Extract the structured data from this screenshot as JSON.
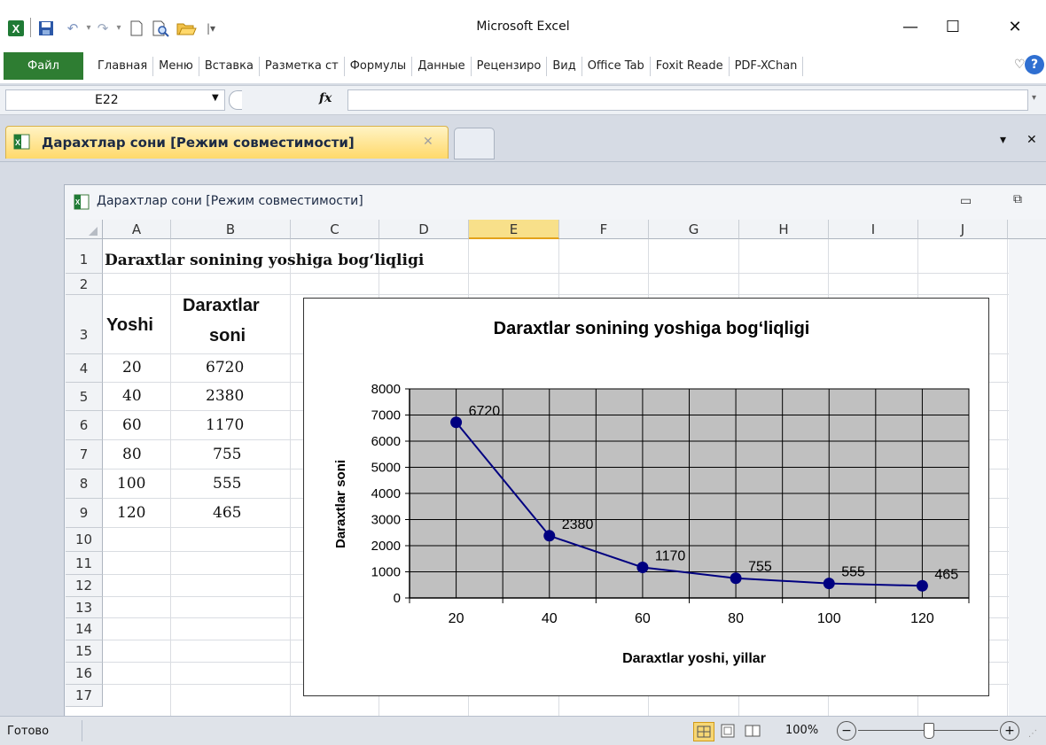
{
  "window": {
    "title": "Microsoft Excel",
    "minimize_glyph": "—",
    "maximize_glyph": "☐",
    "close_glyph": "✕",
    "quick_access": [
      "excel-logo-icon",
      "save-icon",
      "undo-icon",
      "dropdown-icon",
      "redo-icon",
      "dropdown-icon",
      "new-document-icon",
      "print-preview-icon",
      "open-folder-icon",
      "customize-icon"
    ]
  },
  "ribbon": {
    "file_label": "Файл",
    "tabs": [
      "Главная",
      "Меню",
      "Вставка",
      "Разметка ст",
      "Формулы",
      "Данные",
      "Рецензиро",
      "Вид",
      "Office Tab",
      "Foxit Reade",
      "PDF-XChan"
    ],
    "collapse_glyph": "♡",
    "help_glyph": "?"
  },
  "formula_bar": {
    "name_box": "E22",
    "fx_label": "fx",
    "formula": ""
  },
  "doc_tabs": {
    "active_label": "Дарахтлар сони  [Режим совместимости]",
    "close_glyph": "✕",
    "menu_glyph": "▾",
    "close_all_glyph": "✕"
  },
  "inner_window": {
    "title": "Дарахтлар сони  [Режим совместимости]",
    "minimize_glyph": "▭",
    "restore_glyph": "⧉"
  },
  "sheet": {
    "columns": [
      "A",
      "B",
      "C",
      "D",
      "E",
      "F",
      "G",
      "H",
      "I",
      "J"
    ],
    "selected_column": "E",
    "rows": [
      "1",
      "2",
      "3",
      "4",
      "5",
      "6",
      "7",
      "8",
      "9",
      "10",
      "11",
      "12",
      "13",
      "14",
      "15",
      "16",
      "17"
    ],
    "title_cell": "Daraxtlar sonining yoshiga bog‘liqligi",
    "header_yoshi": "Yoshi",
    "header_daraxtlar_line1": "Daraxtlar",
    "header_daraxtlar_line2": "soni",
    "data": [
      {
        "age": "20",
        "count": "6720"
      },
      {
        "age": "40",
        "count": "2380"
      },
      {
        "age": "60",
        "count": "1170"
      },
      {
        "age": "80",
        "count": "755"
      },
      {
        "age": "100",
        "count": "555"
      },
      {
        "age": "120",
        "count": "465"
      }
    ]
  },
  "chart_data": {
    "type": "line",
    "title": "Daraxtlar sonining yoshiga bog‘liqligi",
    "xlabel": "Daraxtlar yoshi,  yillar",
    "ylabel": "Daraxtlar soni",
    "categories": [
      "20",
      "40",
      "60",
      "80",
      "100",
      "120"
    ],
    "series": [
      {
        "values": [
          6720,
          2380,
          1170,
          755,
          555,
          465
        ],
        "color": "#000080"
      }
    ],
    "data_labels": [
      "6720",
      "2380",
      "1170",
      "755",
      "555",
      "465"
    ],
    "ylim": [
      0,
      8000
    ],
    "yticks": [
      "0",
      "1000",
      "2000",
      "3000",
      "4000",
      "5000",
      "6000",
      "7000",
      "8000"
    ],
    "plot_background": "#c0c0c0",
    "grid": true,
    "legend": "none"
  },
  "status_bar": {
    "status": "Готово",
    "zoom": "100%",
    "zoom_minus": "−",
    "zoom_plus": "+"
  }
}
